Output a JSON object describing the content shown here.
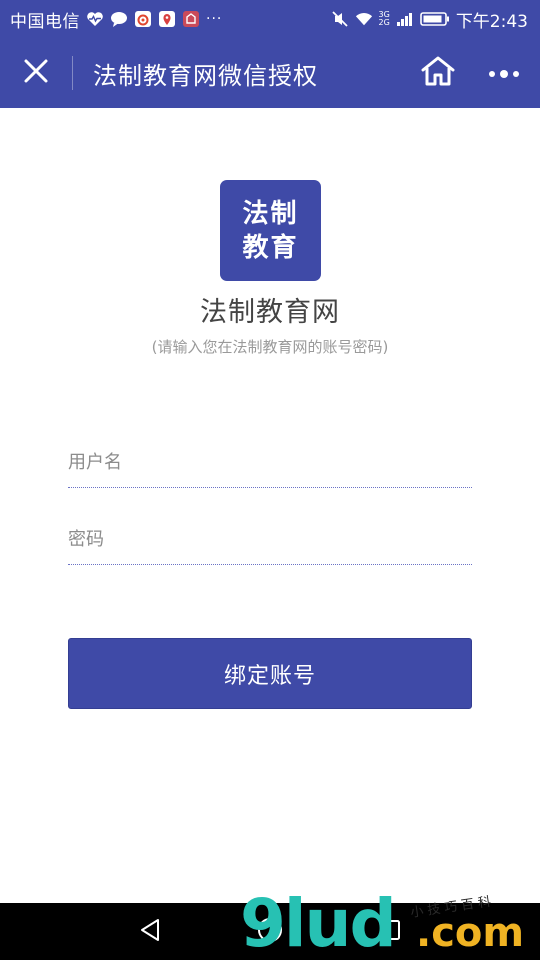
{
  "status_bar": {
    "carrier": "中国电信",
    "overflow": "···",
    "network_top": "3G",
    "network_bottom": "2G",
    "time": "下午2:43"
  },
  "title_bar": {
    "title": "法制教育网微信授权"
  },
  "logo": {
    "line1": "法制",
    "line2": "教育"
  },
  "site_name": "法制教育网",
  "hint": "(请输入您在法制教育网的账号密码)",
  "form": {
    "username_placeholder": "用户名",
    "username_value": "",
    "password_placeholder": "密码",
    "password_value": "",
    "submit_label": "绑定账号"
  },
  "watermark": {
    "brand": "9lud",
    "tld": ".com",
    "slogan": "小技巧百科"
  },
  "colors": {
    "brand": "#3f4aa7",
    "field_underline": "#6b73c6",
    "placeholder": "#8c8c8c",
    "hint": "#9a9a9a",
    "watermark_teal": "#27c1b3",
    "watermark_yellow": "#f0b323"
  },
  "icons": {
    "status": [
      "heart-pulse-icon",
      "chat-bubble-icon",
      "weibo-icon",
      "map-pin-icon",
      "app-icon",
      "mute-icon",
      "wifi-icon",
      "signal-icon",
      "battery-icon"
    ],
    "title_bar": [
      "close-icon",
      "home-icon",
      "more-icon"
    ],
    "nav": [
      "back-icon",
      "home-circle-icon",
      "recents-icon"
    ]
  }
}
